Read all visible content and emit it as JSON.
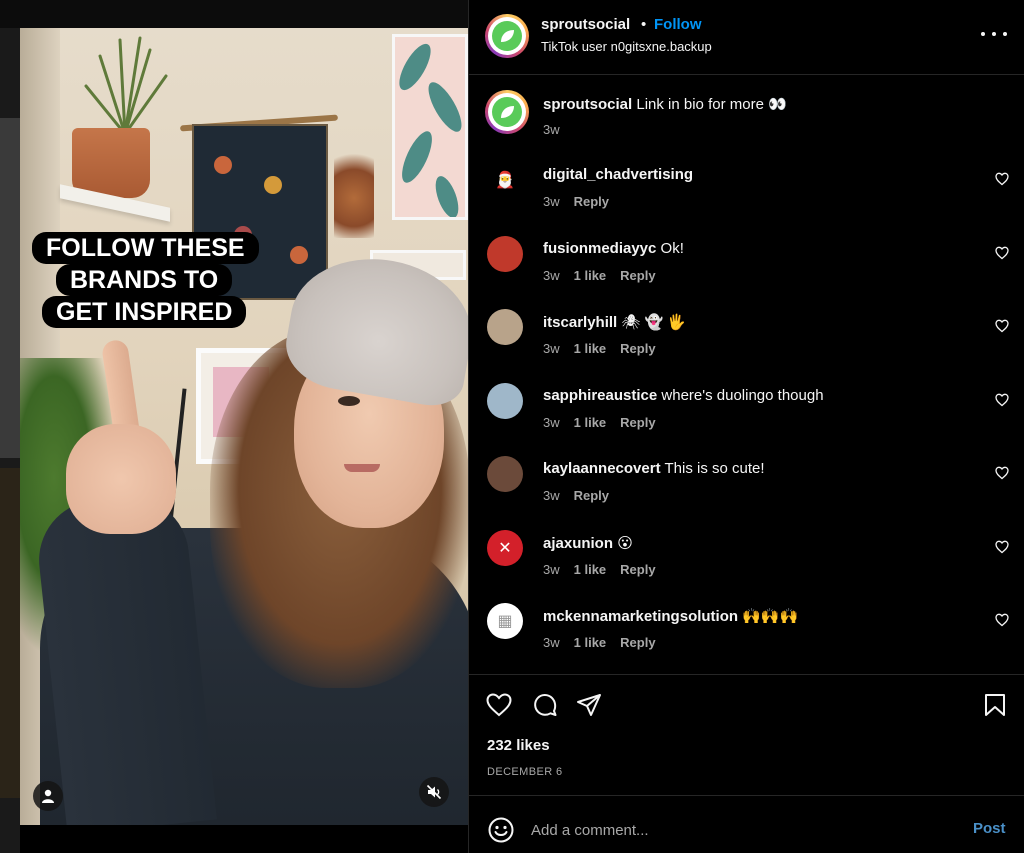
{
  "post": {
    "username": "sproutsocial",
    "separator": "•",
    "follow_label": "Follow",
    "subtitle": "TikTok user n0gitsxne.backup",
    "caption_text": "Link in bio for more 👀",
    "caption_time": "3w",
    "video_caption": [
      "FOLLOW THESE",
      "BRANDS TO",
      "GET INSPIRED"
    ],
    "likes": "232 likes",
    "date": "DECEMBER 6"
  },
  "comments": [
    {
      "username": "digital_chadvertising",
      "text": "",
      "time": "3w",
      "likes": "",
      "reply": "Reply",
      "avatar_color": "#000000",
      "avatar_glyph": "🎅"
    },
    {
      "username": "fusionmediayyc",
      "text": "Ok!",
      "time": "3w",
      "likes": "1 like",
      "reply": "Reply",
      "avatar_color": "#c0392b",
      "avatar_glyph": ""
    },
    {
      "username": "itscarlyhill",
      "text": "🕷 👻 🖐",
      "time": "3w",
      "likes": "1 like",
      "reply": "Reply",
      "avatar_color": "#b8a38a",
      "avatar_glyph": ""
    },
    {
      "username": "sapphireaustice",
      "text": "where's duolingo though",
      "time": "3w",
      "likes": "1 like",
      "reply": "Reply",
      "avatar_color": "#9fb7c9",
      "avatar_glyph": ""
    },
    {
      "username": "kaylaannecovert",
      "text": "This is so cute!",
      "time": "3w",
      "likes": "",
      "reply": "Reply",
      "avatar_color": "#6b4a3a",
      "avatar_glyph": ""
    },
    {
      "username": "ajaxunion",
      "text": "😮",
      "time": "3w",
      "likes": "1 like",
      "reply": "Reply",
      "avatar_color": "#d3202a",
      "avatar_glyph": "✕"
    },
    {
      "username": "mckennamarketingsolution",
      "text": "🙌🙌🙌",
      "time": "3w",
      "likes": "1 like",
      "reply": "Reply",
      "avatar_color": "#ffffff",
      "avatar_glyph": "▦"
    }
  ],
  "composer": {
    "placeholder": "Add a comment...",
    "post_label": "Post"
  },
  "colors": {
    "follow": "#0095f6",
    "post_button": "#4a90c8",
    "brand_green": "#59cb59"
  },
  "icons": [
    "more-options-icon",
    "heart-icon",
    "comment-icon",
    "share-icon",
    "bookmark-icon",
    "emoji-icon",
    "user-tag-icon",
    "mute-icon"
  ]
}
